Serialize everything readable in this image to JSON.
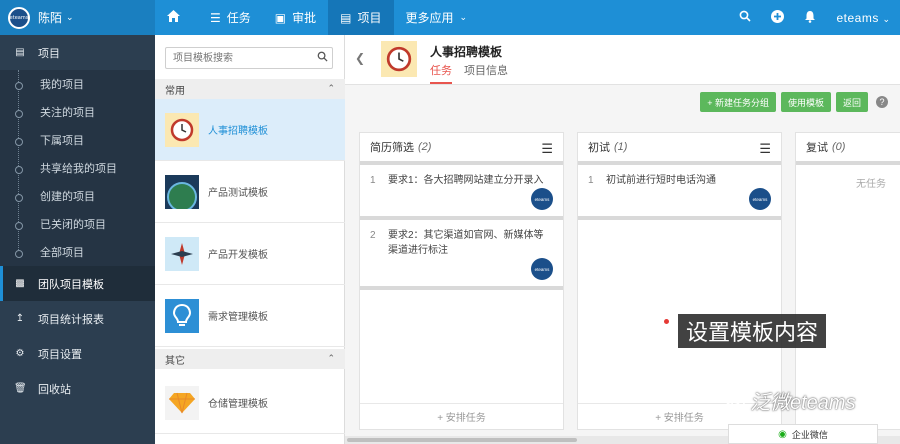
{
  "topbar": {
    "logo_text": "eteams",
    "user": "陈陌",
    "nav": [
      {
        "icon": "home-icon",
        "label": ""
      },
      {
        "icon": "task-list-icon",
        "label": "任务"
      },
      {
        "icon": "approve-icon",
        "label": "审批"
      },
      {
        "icon": "project-icon",
        "label": "项目"
      },
      {
        "icon": "",
        "label": "更多应用"
      }
    ],
    "right_brand": "eteams"
  },
  "sidebar": {
    "project_label": "项目",
    "subitems": [
      "我的项目",
      "关注的项目",
      "下属项目",
      "共享给我的项目",
      "创建的项目",
      "已关闭的项目",
      "全部项目"
    ],
    "sections": [
      "团队项目模板",
      "项目统计报表",
      "项目设置",
      "回收站"
    ]
  },
  "templates": {
    "search_placeholder": "项目模板搜索",
    "group_common": "常用",
    "group_other": "其它",
    "common": [
      "人事招聘模板",
      "产品测试模板",
      "产品开发模板",
      "需求管理模板"
    ],
    "other": [
      "仓储管理模板"
    ]
  },
  "main": {
    "title": "人事招聘模板",
    "tabs": [
      "任务",
      "项目信息"
    ],
    "actions": {
      "new_group": "+ 新建任务分组",
      "use_template": "使用模板",
      "back": "返回",
      "help": "?"
    },
    "columns": [
      {
        "name": "简历筛选",
        "count": "(2)",
        "cards": [
          {
            "num": "1",
            "text": "要求1：各大招聘网站建立分开录入"
          },
          {
            "num": "2",
            "text": "要求2：其它渠道如官网、新媒体等渠道进行标注"
          }
        ]
      },
      {
        "name": "初试",
        "count": "(1)",
        "cards": [
          {
            "num": "1",
            "text": "初试前进行短时电话沟通"
          }
        ]
      },
      {
        "name": "复试",
        "count": "(0)",
        "empty": "无任务"
      }
    ],
    "add_task": "+ 安排任务",
    "avatar_text": "eteams"
  },
  "overlay": {
    "tooltip": "设置模板内容",
    "watermark": "泛微eteams",
    "wechat": "企业微信"
  }
}
